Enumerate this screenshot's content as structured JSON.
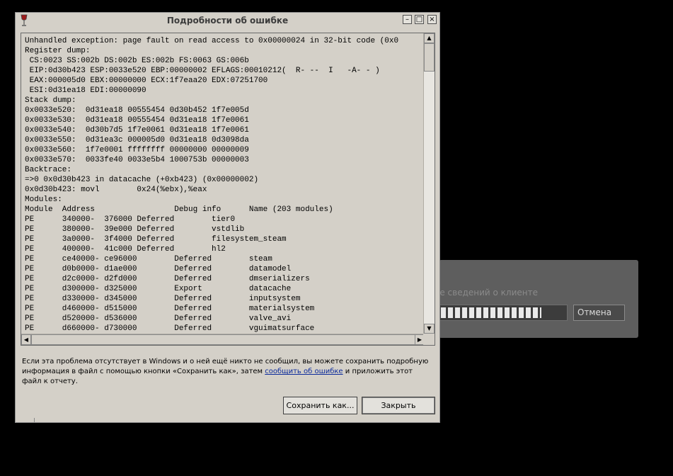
{
  "background_panel": {
    "status_text": "Получение сведений о клиенте...",
    "progress": 0.8,
    "cancel_label": "Отмена"
  },
  "dialog": {
    "title": "Подробности об ошибке",
    "log_lines": [
      "Unhandled exception: page fault on read access to 0x00000024 in 32-bit code (0x0",
      "Register dump:",
      " CS:0023 SS:002b DS:002b ES:002b FS:0063 GS:006b",
      " EIP:0d30b423 ESP:0033e520 EBP:00000002 EFLAGS:00010212(  R- --  I   -A- - )",
      " EAX:000005d0 EBX:00000000 ECX:1f7eaa20 EDX:07251700",
      " ESI:0d31ea18 EDI:00000090",
      "Stack dump:",
      "0x0033e520:  0d31ea18 00555454 0d30b452 1f7e005d",
      "0x0033e530:  0d31ea18 00555454 0d31ea18 1f7e0061",
      "0x0033e540:  0d30b7d5 1f7e0061 0d31ea18 1f7e0061",
      "0x0033e550:  0d31ea3c 000005d0 0d31ea18 0d3098da",
      "0x0033e560:  1f7e0001 ffffffff 00000000 00000009",
      "0x0033e570:  0033fe40 0033e5b4 1000753b 00000003",
      "Backtrace:",
      "=>0 0x0d30b423 in datacache (+0xb423) (0x00000002)",
      "0x0d30b423: movl        0x24(%ebx),%eax",
      "Modules:",
      "Module  Address                 Debug info      Name (203 modules)",
      "PE      340000-  376000 Deferred        tier0",
      "PE      380000-  39e000 Deferred        vstdlib",
      "PE      3a0000-  3f4000 Deferred        filesystem_steam",
      "PE      400000-  41c000 Deferred        hl2",
      "PE      ce40000- ce96000        Deferred        steam",
      "PE      d0b0000- d1ae000        Deferred        datamodel",
      "PE      d2c0000- d2fd000        Deferred        dmserializers",
      "PE      d300000- d325000        Export          datacache",
      "PE      d330000- d345000        Deferred        inputsystem",
      "PE      d460000- d515000        Deferred        materialsystem",
      "PE      d520000- d536000        Deferred        valve_avi",
      "PE      d660000- d730000        Deferred        vguimatsurface"
    ],
    "message_before_link": "Если эта проблема отсутствует в Windows и о ней ещё никто не сообщил, вы можете сохранить подробную информация в файл с помощью кнопки «Сохранить как», затем ",
    "message_link": "сообщить об ошибке",
    "message_after_link": " и приложить этот файл к отчету.",
    "save_as_label": "Сохранить как...",
    "close_label": "Закрыть"
  }
}
